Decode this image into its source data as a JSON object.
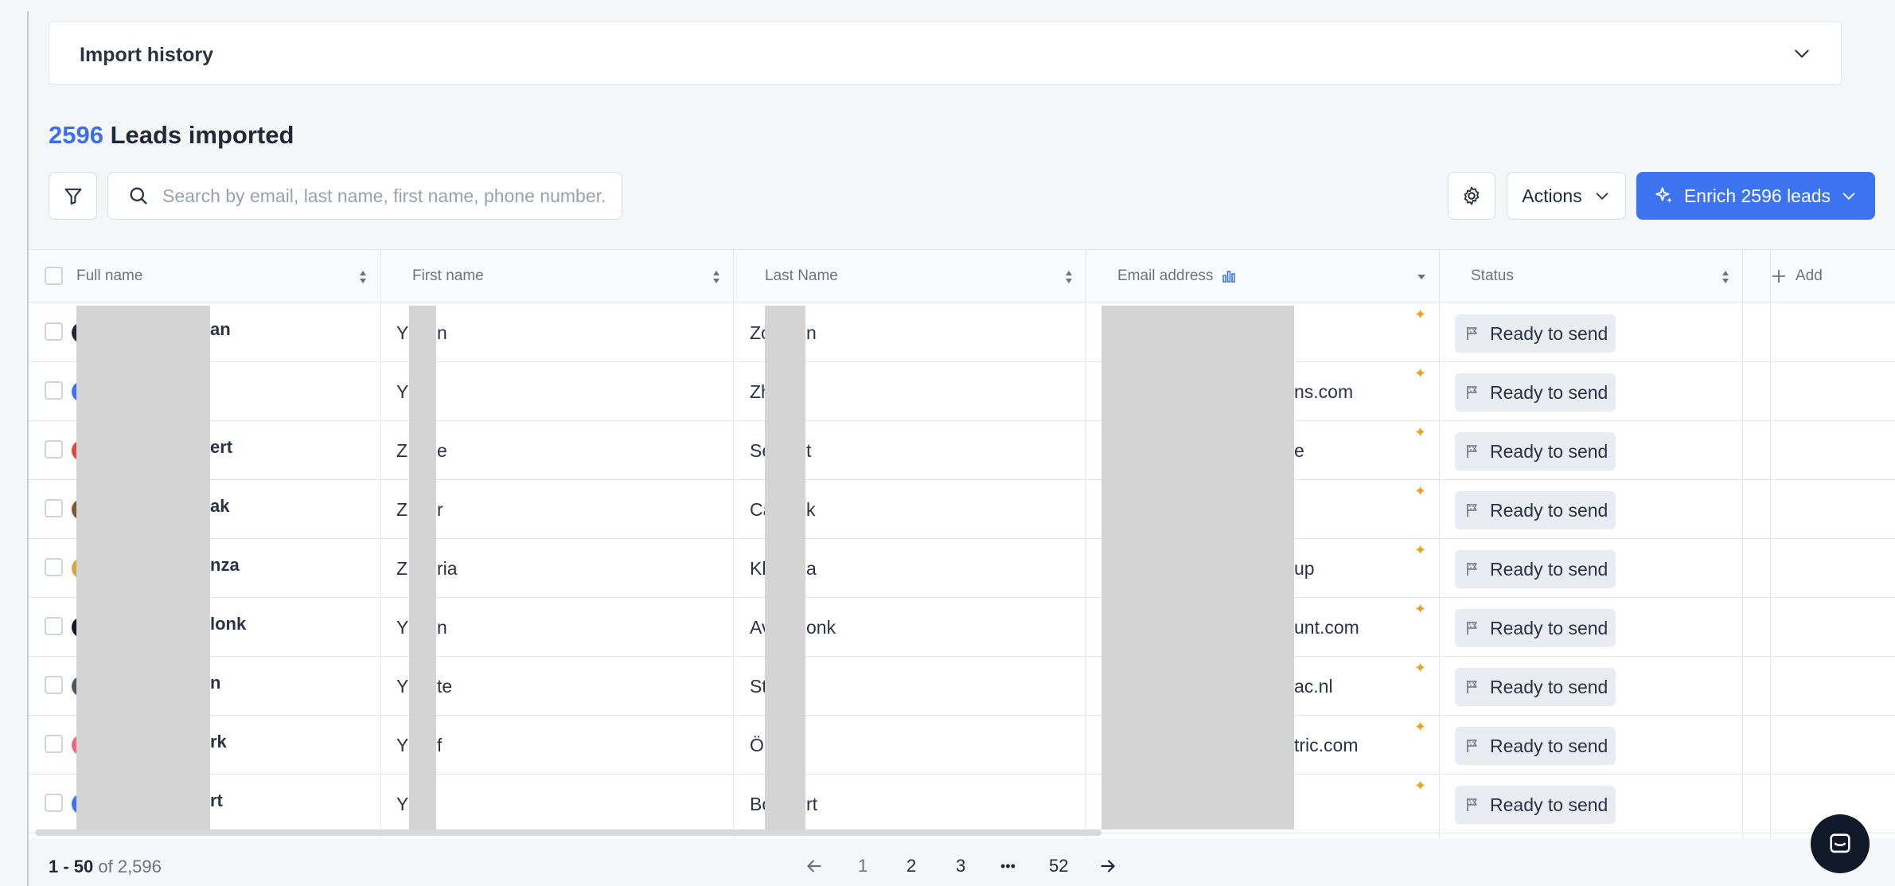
{
  "import_history": {
    "title": "Import history"
  },
  "summary": {
    "count": "2596",
    "label": " Leads imported"
  },
  "search": {
    "placeholder": "Search by email, last name, first name, phone number."
  },
  "toolbar": {
    "actions_label": "Actions",
    "enrich_label": "Enrich 2596 leads"
  },
  "columns": {
    "full_name": "Full name",
    "first_name": "First name",
    "last_name": "Last Name",
    "email": "Email address",
    "status": "Status",
    "add": "Add"
  },
  "rows": [
    {
      "full_name": "an",
      "first_name": [
        "Y",
        "n"
      ],
      "last_name": [
        "Zo",
        "n"
      ],
      "email": "",
      "status": "Ready to send",
      "avatar_color": "#1f2937"
    },
    {
      "full_name": "",
      "first_name": [
        "Y",
        ""
      ],
      "last_name": [
        "Zh",
        ""
      ],
      "email": "ns.com",
      "status": "Ready to send",
      "avatar_color": "#3b74ee"
    },
    {
      "full_name": "ert",
      "first_name": [
        "Z",
        "e"
      ],
      "last_name": [
        "Se",
        "t"
      ],
      "email": "e",
      "status": "Ready to send",
      "avatar_color": "#e0483e"
    },
    {
      "full_name": "ak",
      "first_name": [
        "Z",
        "r"
      ],
      "last_name": [
        "Ca",
        "k"
      ],
      "email": "",
      "status": "Ready to send",
      "avatar_color": "#7a5a2e"
    },
    {
      "full_name": "nza",
      "first_name": [
        "Z",
        "ria"
      ],
      "last_name": [
        "Kh",
        "a"
      ],
      "email": "up",
      "status": "Ready to send",
      "avatar_color": "#d9a441"
    },
    {
      "full_name": "lonk",
      "first_name": [
        "Y",
        "n"
      ],
      "last_name": [
        "Av",
        "onk"
      ],
      "email": "unt.com",
      "status": "Ready to send",
      "avatar_color": "#111827"
    },
    {
      "full_name": "n",
      "first_name": [
        "Y",
        "te"
      ],
      "last_name": [
        "St",
        ""
      ],
      "email": "ac.nl",
      "status": "Ready to send",
      "avatar_color": "#4b5563"
    },
    {
      "full_name": "rk",
      "first_name": [
        "Y",
        "f"
      ],
      "last_name": [
        "Ö",
        ""
      ],
      "email": "tric.com",
      "status": "Ready to send",
      "avatar_color": "#e86a7a"
    },
    {
      "full_name": "rt",
      "first_name": [
        "Y",
        ""
      ],
      "last_name": [
        "Bo",
        "rt"
      ],
      "email": "",
      "status": "Ready to send",
      "avatar_color": "#3b74ee"
    }
  ],
  "footer": {
    "range": "1 - 50",
    "of_text": " of 2,596"
  },
  "pagination": {
    "pages": [
      "1",
      "2",
      "3",
      "•••",
      "52"
    ]
  },
  "colors": {
    "accent": "#3b74ee",
    "count_blue": "#3f6fe0",
    "sparkle": "#e8a321"
  }
}
